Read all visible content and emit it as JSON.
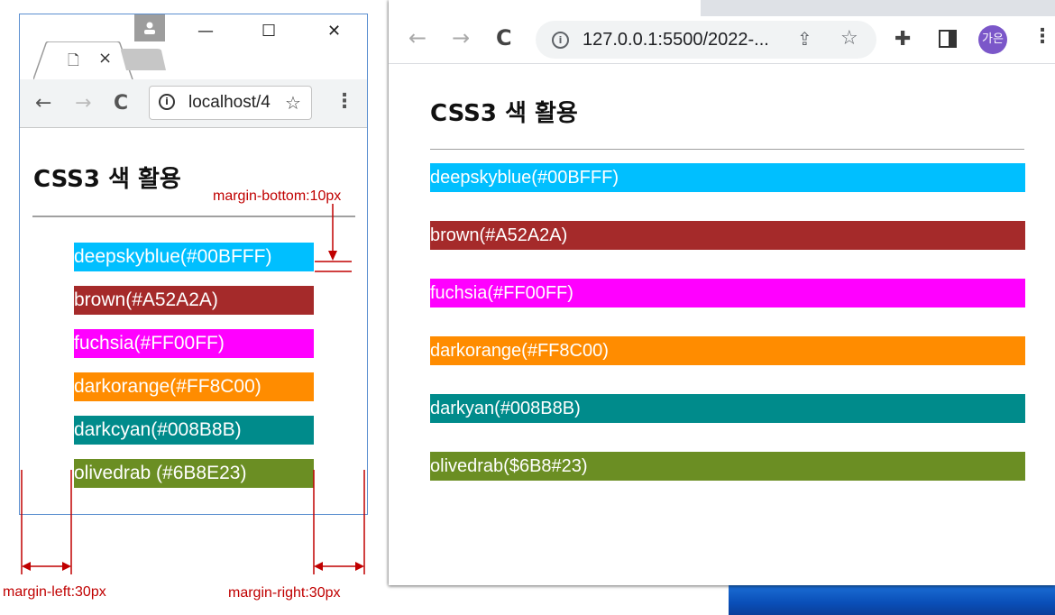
{
  "colors": {
    "deepskyblue": "#00BFFF",
    "brown": "#A52A2A",
    "fuchsia": "#FF00FF",
    "darkorange": "#FF8C00",
    "darkcyan": "#008B8B",
    "olivedrab": "#6B8E23",
    "annotation": "#C00000"
  },
  "left_window": {
    "tab_close": "×",
    "window_controls": {
      "minimize": "—",
      "maximize": "☐",
      "close": "✕"
    },
    "nav": {
      "back": "←",
      "forward": "→",
      "reload": "C"
    },
    "address": "localhost/4",
    "page": {
      "heading": "CSS3 색 활용",
      "bars": [
        {
          "label": "deepskyblue(#00BFFF)",
          "color": "#00BFFF"
        },
        {
          "label": "brown(#A52A2A)",
          "color": "#A52A2A"
        },
        {
          "label": "fuchsia(#FF00FF)",
          "color": "#FF00FF"
        },
        {
          "label": "darkorange(#FF8C00)",
          "color": "#FF8C00"
        },
        {
          "label": "darkcyan(#008B8B)",
          "color": "#008B8B"
        },
        {
          "label": "olivedrab (#6B8E23)",
          "color": "#6B8E23"
        }
      ]
    },
    "annotations": {
      "margin_bottom": "margin-bottom:10px",
      "margin_left": "margin-left:30px",
      "margin_right": "margin-right:30px"
    }
  },
  "right_window": {
    "nav": {
      "back": "←",
      "forward": "→",
      "reload": "C"
    },
    "address": "127.0.0.1:5500/2022-...",
    "avatar_text": "가은",
    "page": {
      "heading": "CSS3 색 활용",
      "bars": [
        {
          "label": "deepskyblue(#00BFFF)",
          "color": "#00BFFF"
        },
        {
          "label": "brown(#A52A2A)",
          "color": "#A52A2A"
        },
        {
          "label": "fuchsia(#FF00FF)",
          "color": "#FF00FF"
        },
        {
          "label": "darkorange(#FF8C00)",
          "color": "#FF8C00"
        },
        {
          "label": "darkyan(#008B8B)",
          "color": "#008B8B"
        },
        {
          "label": "olivedrab($6B8#23)",
          "color": "#6B8E23"
        }
      ]
    }
  }
}
